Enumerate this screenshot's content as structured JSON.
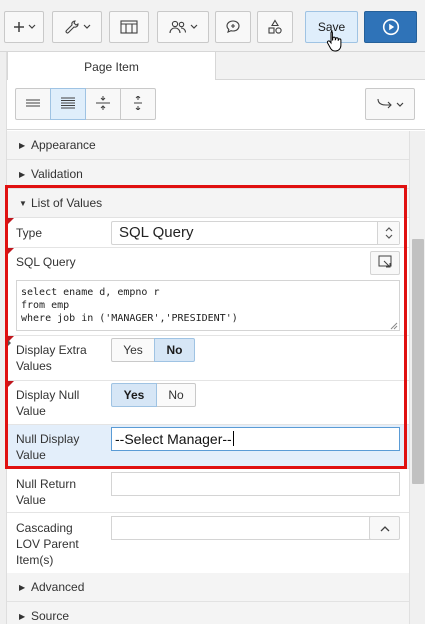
{
  "toolbar": {
    "create_icon": "plus-icon",
    "utilities_icon": "wrench-icon",
    "shared_components_icon": "grid-icon",
    "team_icon": "users-icon",
    "comments_icon": "comment-icon",
    "shapes_icon": "shapes-icon",
    "save_label": "Save",
    "run_icon": "play-icon"
  },
  "tabs": [
    {
      "label": "Page Item"
    }
  ],
  "view_buttons": [
    {
      "icon": "lines-icon",
      "active": false
    },
    {
      "icon": "list-icon",
      "active": true
    },
    {
      "icon": "collapse-icon",
      "active": false
    },
    {
      "icon": "expand-icon",
      "active": false
    }
  ],
  "goto_icon": "goto-arrow-icon",
  "groups": {
    "appearance": "Appearance",
    "validation": "Validation",
    "list_of_values": "List of Values",
    "advanced": "Advanced",
    "source": "Source"
  },
  "properties": {
    "type": {
      "label": "Type",
      "value": "SQL Query"
    },
    "sql_query": {
      "label": "SQL Query",
      "lines": [
        "select ename d, empno r",
        "from emp",
        "where job in ('MANAGER','PRESIDENT')"
      ]
    },
    "display_extra_values": {
      "label_1": "Display Extra",
      "label_2": "Values",
      "yes": "Yes",
      "no": "No",
      "selected": "No"
    },
    "display_null_value": {
      "label_1": "Display Null",
      "label_2": "Value",
      "yes": "Yes",
      "no": "No",
      "selected": "Yes"
    },
    "null_display_value": {
      "label_1": "Null Display",
      "label_2": "Value",
      "value": "--Select Manager--"
    },
    "null_return_value": {
      "label_1": "Null Return",
      "label_2": "Value",
      "value": ""
    },
    "cascading_lov_parent": {
      "label_1": "Cascading",
      "label_2": "LOV Parent",
      "label_3": "Item(s)",
      "value": ""
    }
  },
  "colors": {
    "accent": "#2f73b8",
    "annotation": "#e01010",
    "required": "#c0161d"
  }
}
